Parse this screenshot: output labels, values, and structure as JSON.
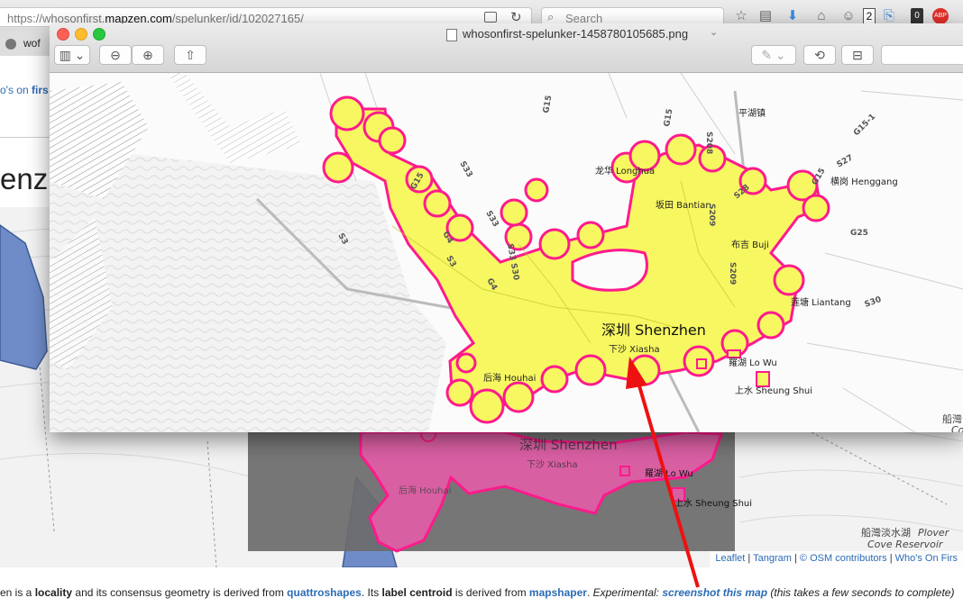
{
  "browser": {
    "url_prefix": "https://whosonfirst.",
    "url_domain": "mapzen.com",
    "url_path": "/spelunker/id/102027165/",
    "search_placeholder": "Search",
    "tab_label": "wof",
    "badge_count": "2"
  },
  "page": {
    "site_link_text": "o's on",
    "site_link_bold": "firs",
    "heading": "enzh",
    "description": {
      "p1": "en is a ",
      "locality": "locality",
      "p2": " and its consensus geometry is derived from ",
      "quattroshapes": "quattroshapes",
      "p3": ". Its ",
      "label_centroid": "label centroid",
      "p4": " is derived from ",
      "mapshaper": "mapshaper",
      "p5": ". ",
      "experimental": "Experimental:",
      "p6": " ",
      "screenshot_link": "screenshot this map",
      "p7": " (this takes a few seconds to complete)"
    },
    "attribution": {
      "leaflet": "Leaflet",
      "tangram": "Tangram",
      "osm": "© OSM contributors",
      "wof": "Who's On Firs",
      "sep": " | "
    },
    "bg_map_labels": {
      "city": "深圳 Shenzhen",
      "xiasha": "下沙 Xiasha",
      "houhai": "后海 Houhai",
      "luohu": "羅湖 Lo Wu",
      "sheungshui": "上水 Sheung Shui",
      "plover_cn": "船灣淡水湖",
      "plover_en": "Plover",
      "plover_en2": "Cove Reservoir",
      "right_cn": "船灣",
      "right_co": "Co"
    }
  },
  "preview": {
    "title": "whosonfirst-spelunker-1458780105685.png",
    "map_labels": {
      "city": "深圳 Shenzhen",
      "xiasha": "下沙 Xiasha",
      "longhua": "龙华 Longhua",
      "bantian": "坂田 Bantian",
      "buji": "布吉 Buji",
      "henggang": "横岗 Henggang",
      "liantang": "莲塘 Liantang",
      "luohu": "羅湖 Lo Wu",
      "sheungshui": "上水 Sheung Shui",
      "houhai": "后海 Houhai",
      "pinghu": "平湖镇",
      "right_cn": "船灣",
      "right_co": "Co"
    },
    "road_labels": [
      "G15",
      "G15",
      "G15",
      "S208",
      "S28",
      "S209",
      "S33",
      "S33",
      "G4",
      "G4",
      "S33 S30",
      "S3",
      "S3",
      "G15-1",
      "S27",
      "G25",
      "S30",
      "S209",
      "G15"
    ]
  },
  "colors": {
    "accent_link": "#2d6cb5",
    "polygon_yellow": "#f7f761",
    "polygon_stroke": "#ff1a8c",
    "polygon_pink": "#d95fa3",
    "arrow_red": "#ee1111"
  }
}
